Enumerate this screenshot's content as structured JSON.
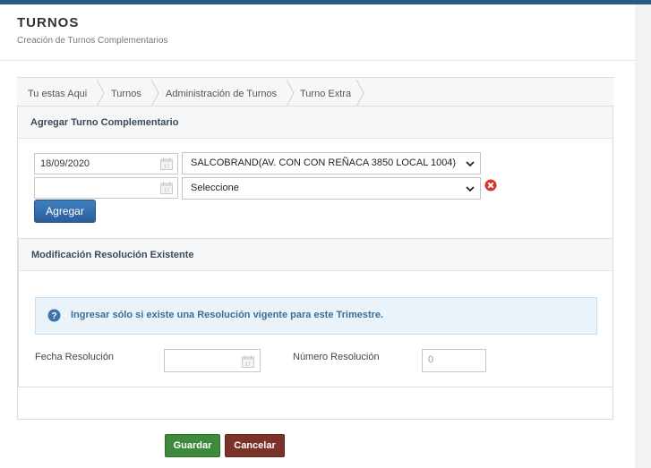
{
  "header": {
    "title": "TURNOS",
    "subtitle": "Creación de Turnos Complementarios"
  },
  "breadcrumb": [
    {
      "label": "Tu estas Aqui"
    },
    {
      "label": "Turnos"
    },
    {
      "label": "Administración de Turnos"
    },
    {
      "label": "Turno Extra"
    }
  ],
  "agregar": {
    "title": "Agregar Turno Complementario",
    "rows": [
      {
        "date_value": "18/09/2020",
        "select_value": "SALCOBRAND(AV. CON CON REÑACA 3850 LOCAL 1004)"
      },
      {
        "date_value": "",
        "select_value": "Seleccione"
      }
    ],
    "add_button": "Agregar"
  },
  "modificacion": {
    "title": "Modificación Resolución Existente",
    "info": "Ingresar sólo si existe una Resolución vigente para este Trimestre.",
    "fecha_label": "Fecha Resolución",
    "fecha_value": "",
    "numero_label": "Número Resolución",
    "numero_value": "0"
  },
  "actions": {
    "save": "Guardar",
    "cancel": "Cancelar"
  },
  "colors": {
    "primary": "#2a5f9a",
    "success": "#3d8a3d",
    "danger": "#7a3329",
    "remove_icon": "#d9342b",
    "info_bg": "#e9f3f9",
    "info_text": "#3a6f9a"
  },
  "icons": [
    "calendar-icon",
    "chevron-down-icon",
    "remove-icon",
    "question-icon",
    "breadcrumb-separator-icon"
  ]
}
